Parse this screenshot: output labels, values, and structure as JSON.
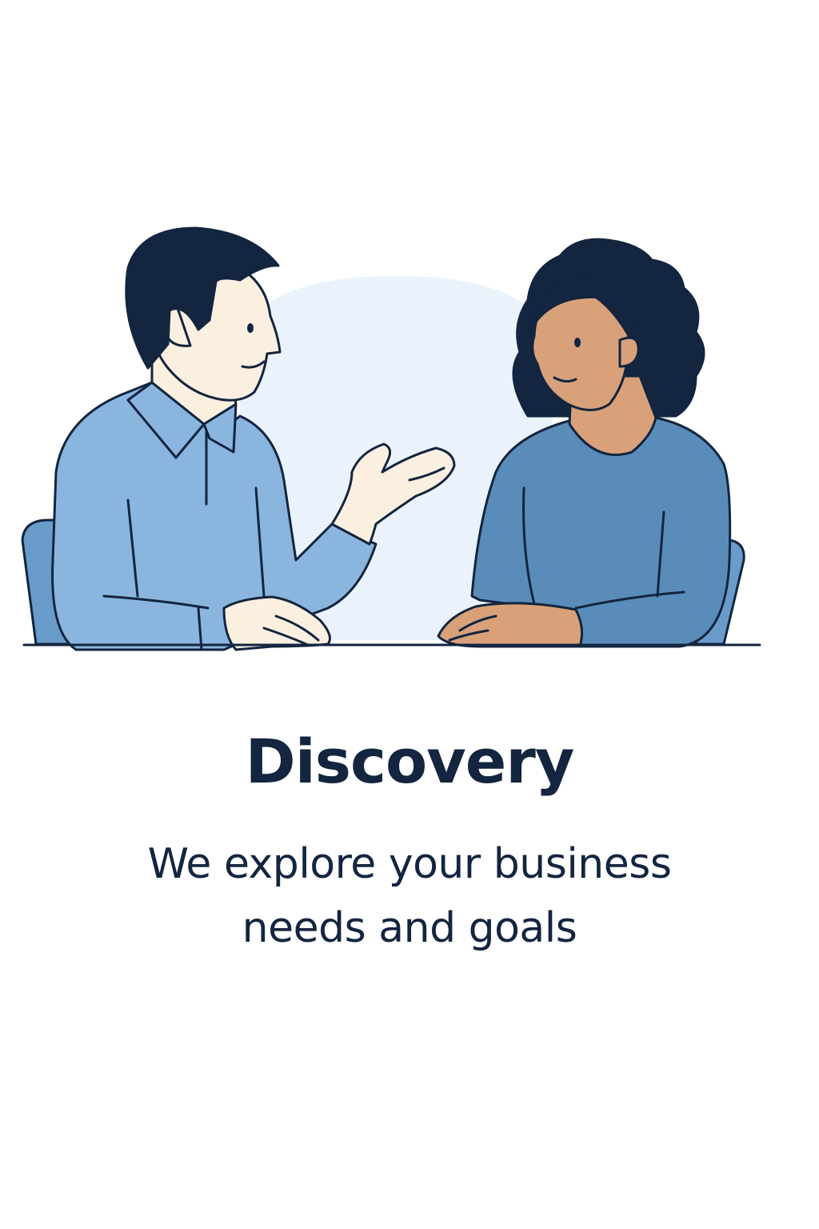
{
  "illustration": {
    "subject": "Two people sitting at a table having a conversation",
    "colors": {
      "outline": "#13253f",
      "backdrop": "#eaf3fc",
      "man_shirt": "#8ab5df",
      "woman_sweater": "#5a8cba",
      "chair": "#6a9ccb",
      "man_skin": "#fbefe0",
      "woman_skin": "#d9a17a",
      "hair": "#13253f"
    }
  },
  "title": "Discovery",
  "description": "We explore your business needs and goals"
}
